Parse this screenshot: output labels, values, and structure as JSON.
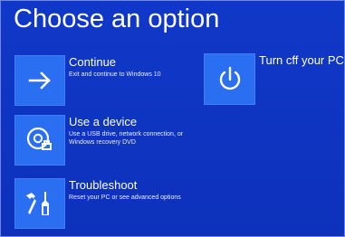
{
  "page": {
    "title": "Choose an option"
  },
  "options": [
    {
      "label": "Continue",
      "description": "Exit and continue to Windows 10",
      "icon": "arrow-right-icon"
    },
    {
      "label": "Use a device",
      "description": "Use a USB drive, network connection, or Windows recovery DVD",
      "icon": "device-disc-icon"
    },
    {
      "label": "Troubleshoot",
      "description": "Reset your PC or see advanced options",
      "icon": "tools-icon"
    },
    {
      "label": "Turn cff your PC",
      "description": "",
      "icon": "power-icon"
    }
  ],
  "colors": {
    "background": "#1038c8",
    "tile": "#2a6ef1",
    "text": "#ffffff"
  }
}
